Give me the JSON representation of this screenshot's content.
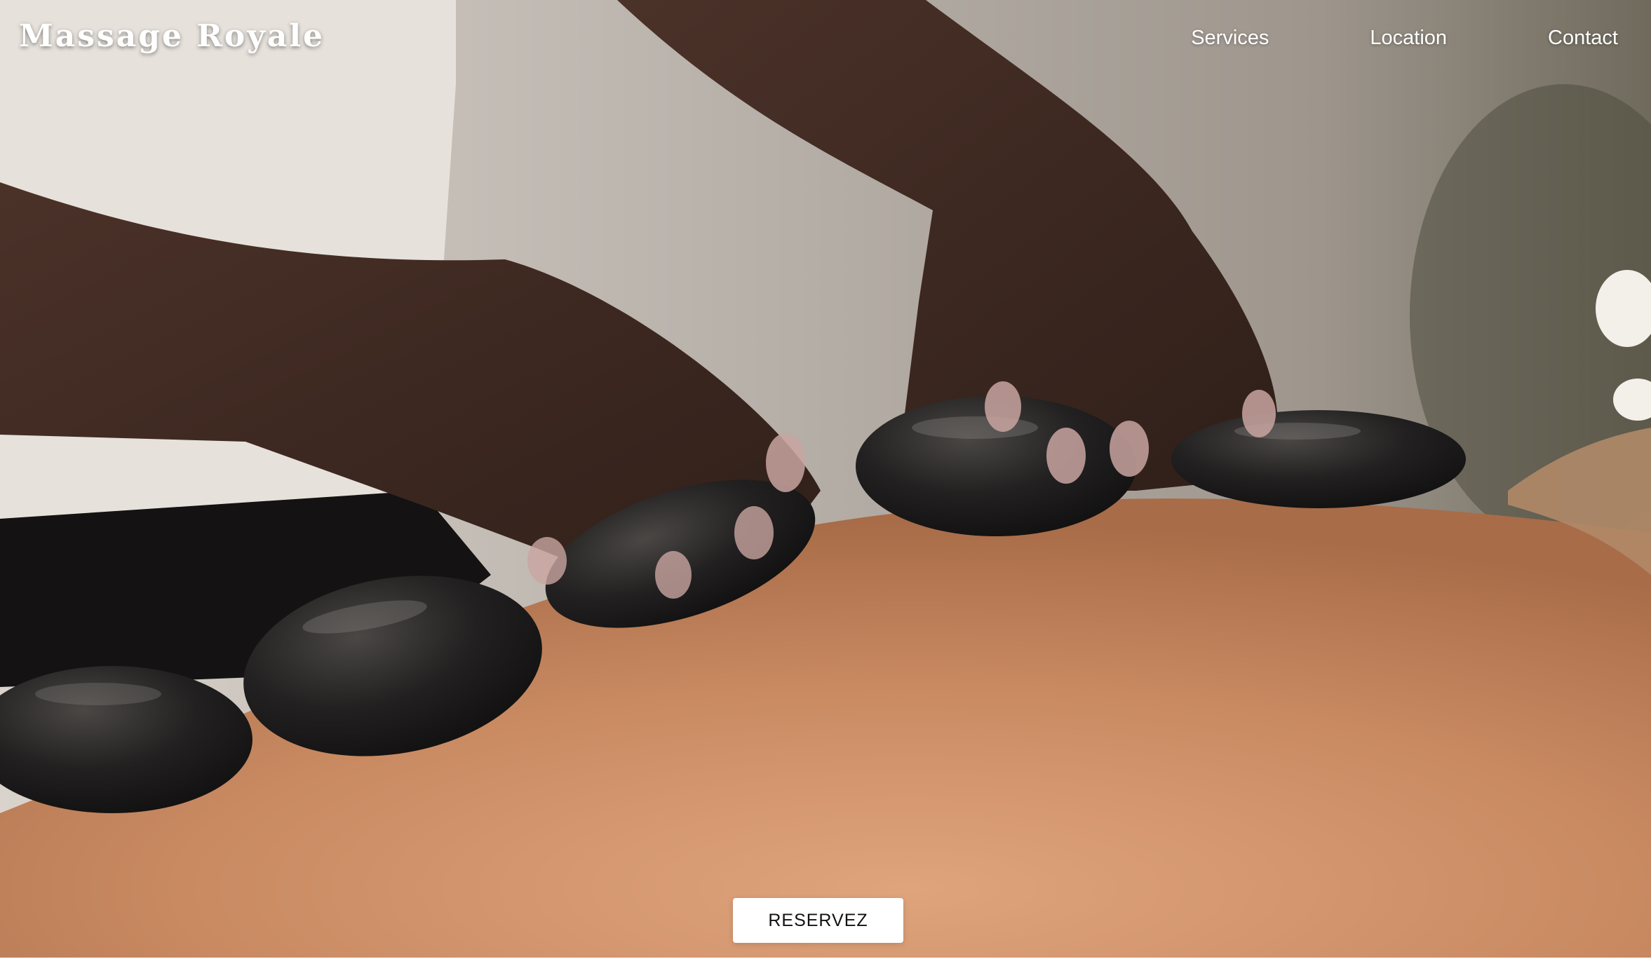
{
  "brand": {
    "name": "Massage Royale"
  },
  "nav": {
    "items": [
      {
        "label": "Services"
      },
      {
        "label": "Location"
      },
      {
        "label": "Contact"
      }
    ]
  },
  "hero": {
    "image_description_icon": "hot-stone-massage-photo",
    "cta_label": "RESERVEZ"
  },
  "colors": {
    "nav_text": "#ffffff",
    "cta_background": "#ffffff",
    "cta_text": "#111111",
    "skin_back": "#c98a62",
    "stones": "#1c1a19",
    "hands": "#3e2a22",
    "shirt": "#e6e1db"
  }
}
